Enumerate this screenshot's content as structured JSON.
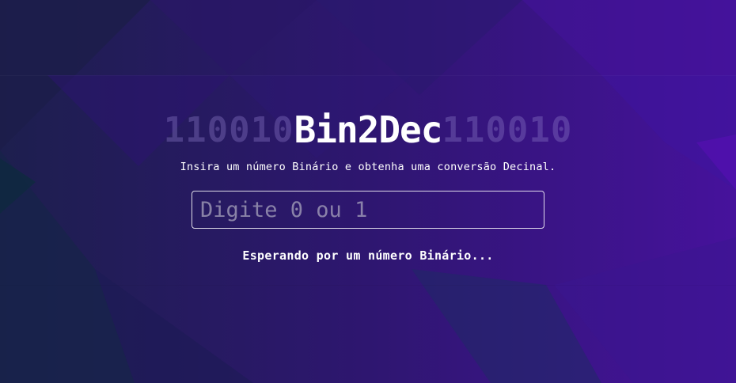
{
  "app": {
    "title": "Bin2Dec",
    "decoration_left": "110010",
    "decoration_right": "110010",
    "subtitle": "Insira um número Binário e obtenha uma conversão Decinal."
  },
  "input": {
    "value": "",
    "placeholder": "Digite 0 ou 1"
  },
  "status": {
    "message": "Esperando por um número Binário..."
  },
  "colors": {
    "background_dark": "#1a2150",
    "background_purple": "#3b1480",
    "background_violet": "#4a12a0",
    "text": "#ffffff",
    "decoration": "#6a5aa8"
  }
}
